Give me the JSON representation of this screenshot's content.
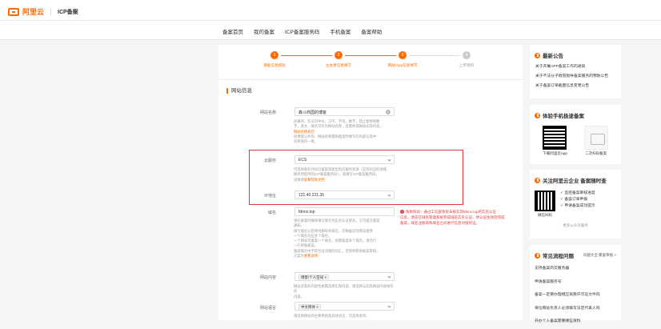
{
  "header": {
    "brand": "阿里云",
    "product": "ICP备案"
  },
  "nav": [
    "备案首页",
    "我的备案",
    "ICP备案服务码",
    "手机备案",
    "备案帮助"
  ],
  "steps": [
    {
      "num": "1",
      "label": "基础信息校验"
    },
    {
      "num": "2",
      "label": "主办者信息填写"
    },
    {
      "num": "3",
      "label": "网站/App信息填写"
    },
    {
      "num": "4",
      "label": "上传资料"
    }
  ],
  "section_title": "网站信息",
  "site_name": {
    "label": "网站名称",
    "value": "森斗商国的博客",
    "clear": "×",
    "hint": [
      "必填项，仅支持中文、汉字、字母、数字，禁止使用纯数",
      "字，英文、域名可作为网站名称，且需体现网站实际内容，",
      "网站名称规范",
      "如博客以外的，网站名称需和备案时填写的内容与其中",
      "名称保持一致。"
    ],
    "hint_link": "网站名称规范"
  },
  "cloud": {
    "label": "云服务",
    "value": "ECS",
    "hint": [
      "可选择备有代码已备案等类型的云服务资源（实际对应的地域",
      "服务所提供的ICP备案服务码），或填写ICP备案服务码，",
      "详情请"
    ],
    "hint_link": "查看帮助文档"
  },
  "ip": {
    "label": "IP地址",
    "value": "121.40.221.35"
  },
  "domain": {
    "label": "域名",
    "value": "fdnnx.top",
    "hint": [
      "请在备案时确保填写域名为实名认证状态，方可提交备案",
      "通知。",
      "填写域名以后请勿删除各域名，可根据实际情况提供",
      "一个域名对应多个域名。",
      "一个网站可备案一个域名，如需备案多个域名，请另行",
      "一行单独备案。",
      "备案域名中不得包含违规的词汇，否则将影响备案审核，",
      "方案为"
    ],
    "hint_link": "查看说明"
  },
  "error": {
    "icon": "!",
    "lines": [
      "系统校验：通过工信部系统未核实到fdnnx.top的实名认证",
      "信息，请先在域名管理系统完成域名实名认证，待认证生效后完成",
      "备案，域名注册商和域名之间进行信息对接验证。"
    ]
  },
  "content": {
    "label": "网站内容",
    "tag": "博客/个人空间",
    "tag_x": "×",
    "hint": [
      "网站涉及的内容性质需选择实际内容，请选择与实际网站内容相符的",
      "内容。"
    ]
  },
  "language": {
    "label": "网站语言",
    "tag": "中文简体",
    "tag_x": "×",
    "hint": [
      "请选择网站的主要用语及其他语言，可选择多项。"
    ]
  },
  "sidebar": {
    "news_title": "最新公告",
    "news": [
      "关于开展APP备案工作的通知",
      "关于不法分子假冒指导备案服务的预防公告",
      "关于备案订单截图信息变更公告"
    ],
    "mobile_title": "体验手机极速备案",
    "qr1_label": "下载阿里云App",
    "qr2_label": "二次扫码备案",
    "follow_title": "关注阿里云企业 备案随时查",
    "follow_label": "微信扫码",
    "follow_items": [
      "✓ 监控备案审核进度",
      "✓ 备案订单申报",
      "✓ 申请备案成功提示"
    ],
    "follow_more": "更多公众号服务",
    "faq_title": "常见流程问题",
    "faq_link": "问题大全 繁复审核 >",
    "faq": [
      "支持备案的云服务器",
      "申请备案服务号",
      "备案一定要办理相应资质许可证文件吗",
      "单位网站负责人必须填写法定代表人吗",
      "开办个人备案需要哪些资料"
    ]
  }
}
